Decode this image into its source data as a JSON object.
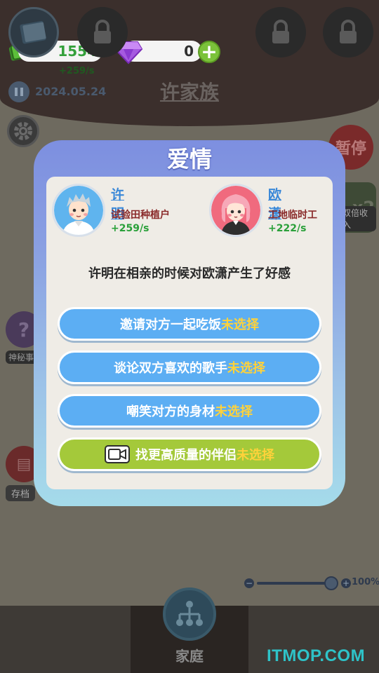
{
  "hud": {
    "money": "1554",
    "income_rate": "+259/s",
    "gems": "0",
    "date": "2024.05.24",
    "family_name": "许家族",
    "pause_label": "暂停",
    "double_income_label": "双倍收入",
    "double_income_badge": "x2",
    "mystery_label": "神秘事件",
    "archive_label": "存档",
    "speed_percent": "100%",
    "speed_level": 1.0
  },
  "bottom_nav": {
    "family_label": "家庭"
  },
  "watermark": "ITMOP.COM",
  "modal": {
    "title": "爱情",
    "person_left": {
      "name": "许明",
      "job": "试验田种植户",
      "rate": "+259/s"
    },
    "person_right": {
      "name": "欧潇",
      "job": "工地临时工",
      "rate": "+222/s"
    },
    "event_text": "许明在相亲的时候对欧潇产生了好感",
    "unselected_label": "未选择",
    "options": [
      {
        "label": "邀请对方一起吃饭"
      },
      {
        "label": "谈论双方喜欢的歌手"
      },
      {
        "label": "嘲笑对方的身材"
      },
      {
        "label": "找更高质量的伴侣"
      }
    ]
  },
  "colors": {
    "modal_top": "#7d8fe0",
    "modal_bottom": "#a5dbea",
    "option_blue": "#5caef3",
    "option_green": "#a4c93a",
    "unselected_yellow": "#ffd23a",
    "name_blue": "#3a88d8",
    "job_red": "#8a2a2a",
    "rate_green": "#2aa03a"
  },
  "icons": [
    "money-icon",
    "gem-icon",
    "plus-icon",
    "pause-icon",
    "gear-icon",
    "question-icon",
    "archive-icon",
    "book-icon",
    "lock-icon",
    "family-tree-icon",
    "video-icon"
  ]
}
